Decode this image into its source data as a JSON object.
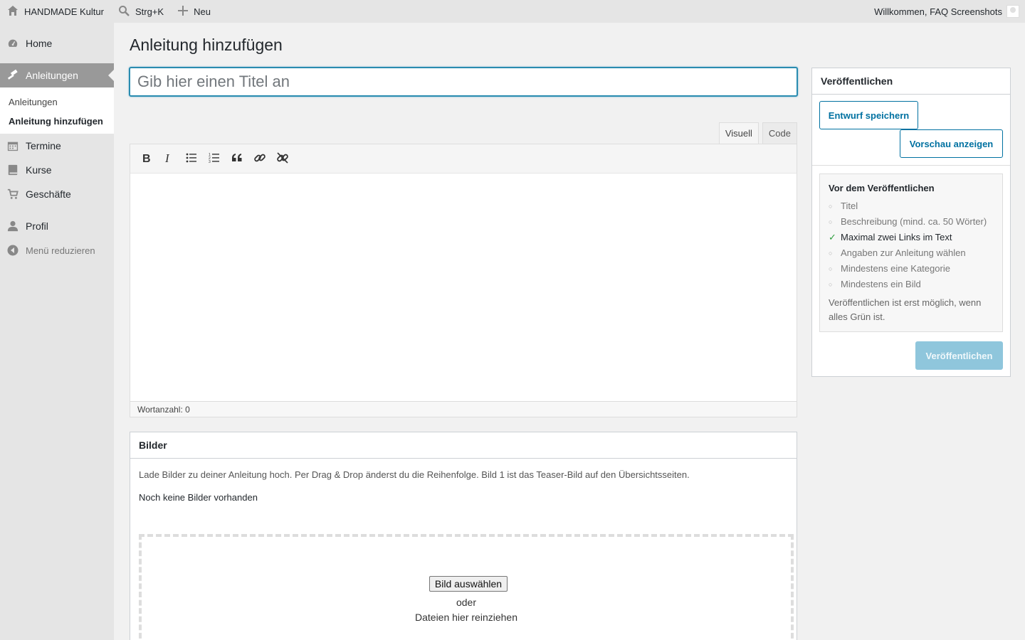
{
  "adminbar": {
    "site_name": "HANDMADE Kultur",
    "search_shortcut": "Strg+K",
    "new_label": "Neu",
    "welcome": "Willkommen, FAQ Screenshots"
  },
  "sidebar": {
    "items": [
      {
        "label": "Home",
        "icon": "dashboard-icon"
      },
      {
        "label": "Anleitungen",
        "icon": "hammer-icon"
      },
      {
        "label": "Termine",
        "icon": "calendar-icon"
      },
      {
        "label": "Kurse",
        "icon": "book-icon"
      },
      {
        "label": "Geschäfte",
        "icon": "cart-icon"
      },
      {
        "label": "Profil",
        "icon": "user-icon"
      }
    ],
    "submenu": [
      "Anleitungen",
      "Anleitung hinzufügen"
    ],
    "collapse_label": "Menü reduzieren"
  },
  "main": {
    "page_title": "Anleitung hinzufügen",
    "title_placeholder": "Gib hier einen Titel an"
  },
  "editor": {
    "tab_visual": "Visuell",
    "tab_code": "Code",
    "toolbar": [
      "bold-icon",
      "italic-icon",
      "bulleted-list-icon",
      "numbered-list-icon",
      "blockquote-icon",
      "link-icon",
      "unlink-icon"
    ],
    "word_count": "Wortanzahl: 0"
  },
  "bilder": {
    "title": "Bilder",
    "description": "Lade Bilder zu deiner Anleitung hoch. Per Drag & Drop änderst du die Reihenfolge. Bild 1 ist das Teaser-Bild auf den Übersichtsseiten.",
    "empty": "Noch keine Bilder vorhanden",
    "pick_button": "Bild auswählen",
    "or": "oder",
    "drag_text": "Dateien hier reinziehen"
  },
  "publish": {
    "title": "Veröffentlichen",
    "save_draft": "Entwurf speichern",
    "preview": "Vorschau anzeigen",
    "checklist_title": "Vor dem Veröffentlichen",
    "checklist": [
      {
        "label": "Titel",
        "done": false
      },
      {
        "label": "Beschreibung (mind. ca. 50 Wörter)",
        "done": false
      },
      {
        "label": "Maximal zwei Links im Text",
        "done": true
      },
      {
        "label": "Angaben zur Anleitung wählen",
        "done": false
      },
      {
        "label": "Mindestens eine Kategorie",
        "done": false
      },
      {
        "label": "Mindestens ein Bild",
        "done": false
      }
    ],
    "note": "Veröffentlichen ist erst möglich, wenn alles Grün ist.",
    "publish_button": "Veröffentlichen",
    "accent_color": "#0071a1",
    "done_color": "#2e9e3e"
  }
}
